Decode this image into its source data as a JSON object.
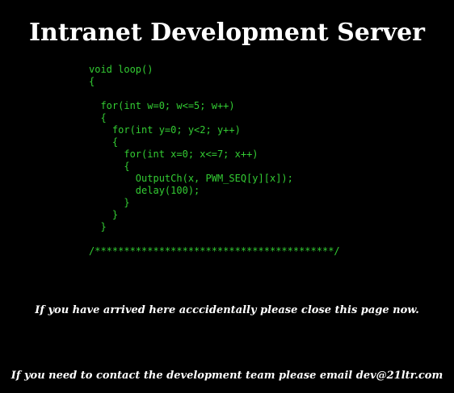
{
  "header": {
    "title": "Intranet Development Server"
  },
  "code": {
    "color": "#33cc33",
    "lines": [
      "void loop()",
      "{",
      "",
      "  for(int w=0; w<=5; w++)",
      "  {",
      "    for(int y=0; y<2; y++)",
      "    {",
      "      for(int x=0; x<=7; x++)",
      "      {",
      "        OutputCh(x, PWM_SEQ[y][x]);",
      "        delay(100);",
      "      }",
      "    }",
      "  }",
      "",
      "/*****************************************/"
    ]
  },
  "notices": {
    "accidental": "If you have arrived here acccidentally please close this page now.",
    "contact": "If you need to contact the development team please email dev@21ltr.com"
  }
}
